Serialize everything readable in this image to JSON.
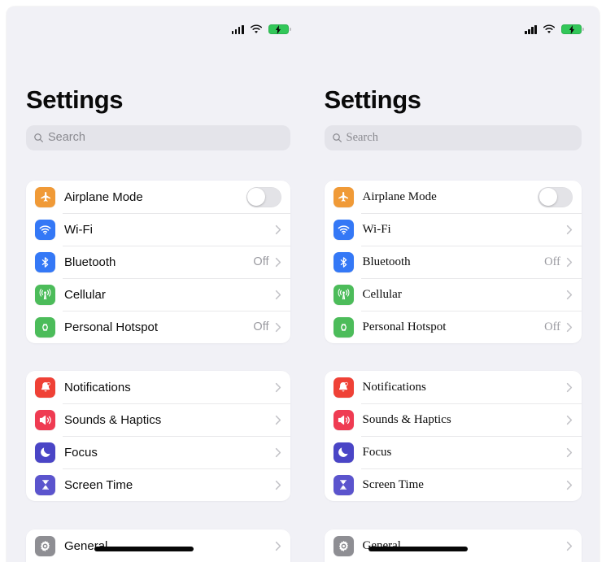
{
  "background_color": "#f1f1f6",
  "card_color": "#ffffff",
  "status_bar": {
    "cellular_icon": "cellular-signal-icon",
    "cellular_bars": 4,
    "wifi_icon": "wifi-icon",
    "battery_icon": "battery-charging-icon",
    "battery_charging": true,
    "battery_color": "#32c759"
  },
  "panes": [
    {
      "id": "left",
      "font_style": "sans",
      "title": "Settings",
      "search": {
        "placeholder": "Search",
        "value": "",
        "icon": "search-icon"
      },
      "groups": [
        {
          "id": "connectivity",
          "rows": [
            {
              "label": "Airplane Mode",
              "icon": "airplane-icon",
              "icon_color": "#f09a37",
              "accessory": "toggle",
              "toggle_on": false,
              "value": ""
            },
            {
              "label": "Wi-Fi",
              "icon": "wifi-icon",
              "icon_color": "#3478f6",
              "accessory": "chevron",
              "value": ""
            },
            {
              "label": "Bluetooth",
              "icon": "bluetooth-icon",
              "icon_color": "#3478f6",
              "accessory": "chevron",
              "value": "Off"
            },
            {
              "label": "Cellular",
              "icon": "cellular-antenna-icon",
              "icon_color": "#4cbc5a",
              "accessory": "chevron",
              "value": ""
            },
            {
              "label": "Personal Hotspot",
              "icon": "hotspot-link-icon",
              "icon_color": "#4cbc5a",
              "accessory": "chevron",
              "value": "Off"
            }
          ]
        },
        {
          "id": "alerts",
          "rows": [
            {
              "label": "Notifications",
              "icon": "notification-bell-icon",
              "icon_color": "#ef4136",
              "accessory": "chevron",
              "value": ""
            },
            {
              "label": "Sounds & Haptics",
              "icon": "speaker-icon",
              "icon_color": "#ef3b52",
              "accessory": "chevron",
              "value": ""
            },
            {
              "label": "Focus",
              "icon": "moon-icon",
              "icon_color": "#4a45c6",
              "accessory": "chevron",
              "value": ""
            },
            {
              "label": "Screen Time",
              "icon": "hourglass-icon",
              "icon_color": "#5b54cd",
              "accessory": "chevron",
              "value": ""
            }
          ]
        },
        {
          "id": "system",
          "rows": [
            {
              "label": "General",
              "icon": "gear-icon",
              "icon_color": "#8e8e93",
              "accessory": "chevron",
              "value": "",
              "annotated": true
            }
          ]
        }
      ]
    },
    {
      "id": "right",
      "font_style": "serif",
      "title": "Settings",
      "search": {
        "placeholder": "Search",
        "value": "",
        "icon": "search-icon"
      },
      "groups": [
        {
          "id": "connectivity",
          "rows": [
            {
              "label": "Airplane Mode",
              "icon": "airplane-icon",
              "icon_color": "#f09a37",
              "accessory": "toggle",
              "toggle_on": false,
              "value": ""
            },
            {
              "label": "Wi-Fi",
              "icon": "wifi-icon",
              "icon_color": "#3478f6",
              "accessory": "chevron",
              "value": ""
            },
            {
              "label": "Bluetooth",
              "icon": "bluetooth-icon",
              "icon_color": "#3478f6",
              "accessory": "chevron",
              "value": "Off"
            },
            {
              "label": "Cellular",
              "icon": "cellular-antenna-icon",
              "icon_color": "#4cbc5a",
              "accessory": "chevron",
              "value": ""
            },
            {
              "label": "Personal Hotspot",
              "icon": "hotspot-link-icon",
              "icon_color": "#4cbc5a",
              "accessory": "chevron",
              "value": "Off"
            }
          ]
        },
        {
          "id": "alerts",
          "rows": [
            {
              "label": "Notifications",
              "icon": "notification-bell-icon",
              "icon_color": "#ef4136",
              "accessory": "chevron",
              "value": ""
            },
            {
              "label": "Sounds & Haptics",
              "icon": "speaker-icon",
              "icon_color": "#ef3b52",
              "accessory": "chevron",
              "value": ""
            },
            {
              "label": "Focus",
              "icon": "moon-icon",
              "icon_color": "#4a45c6",
              "accessory": "chevron",
              "value": ""
            },
            {
              "label": "Screen Time",
              "icon": "hourglass-icon",
              "icon_color": "#5b54cd",
              "accessory": "chevron",
              "value": ""
            }
          ]
        },
        {
          "id": "system",
          "rows": [
            {
              "label": "General",
              "icon": "gear-icon",
              "icon_color": "#8e8e93",
              "accessory": "chevron",
              "value": "",
              "annotated": true
            }
          ]
        }
      ]
    }
  ],
  "annotation": {
    "name": "black-strikethrough-stroke",
    "color": "#070707"
  }
}
